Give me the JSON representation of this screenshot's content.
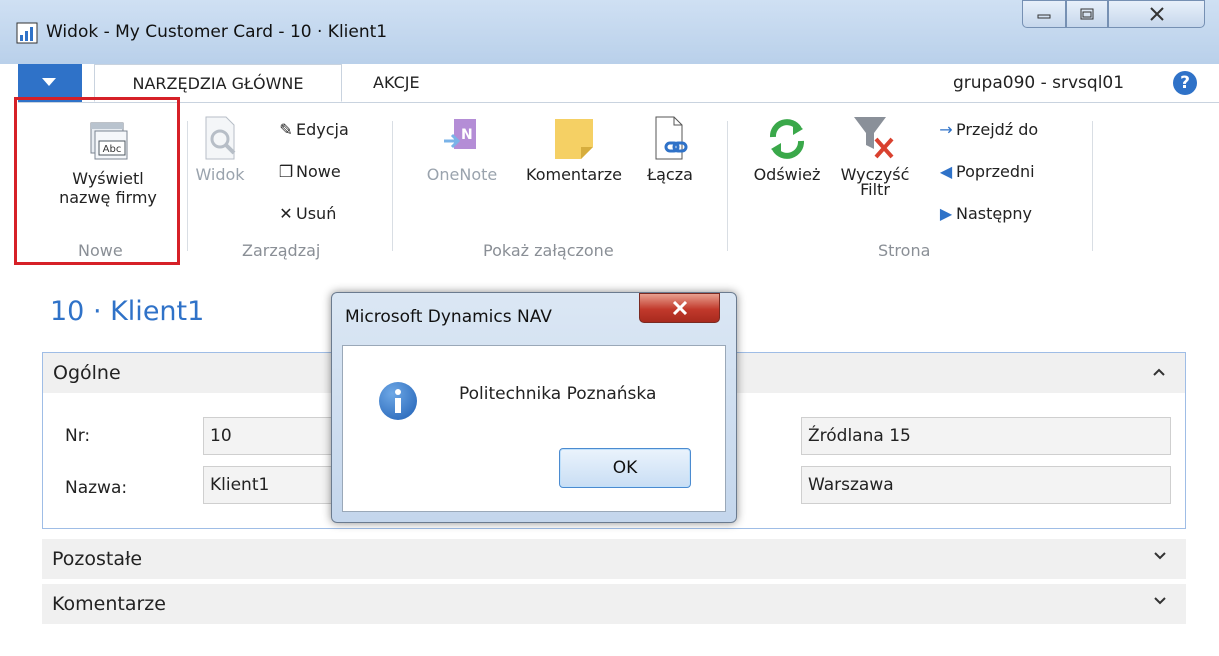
{
  "window": {
    "title": "Widok - My Customer Card - 10 · Klient1"
  },
  "tabs": {
    "home_label": "NARZĘDZIA GŁÓWNE",
    "actions_label": "AKCJE",
    "user_info": "grupa090 - srvsql01",
    "help_label": "?"
  },
  "ribbon": {
    "show_company_line1": "Wyświetl",
    "show_company_line2": "nazwę firmy",
    "group_new": "Nowe",
    "view_label": "Widok",
    "edit_label": "Edycja",
    "new_label": "Nowe",
    "delete_label": "Usuń",
    "group_manage": "Zarządzaj",
    "onenote_label": "OneNote",
    "comments_label": "Komentarze",
    "links_label": "Łącza",
    "group_attachments": "Pokaż załączone",
    "refresh_label": "Odśwież",
    "clear_filter_line1": "Wyczyść",
    "clear_filter_line2": "Filtr",
    "goto_label": "Przejdź do",
    "previous_label": "Poprzedni",
    "next_label": "Następny",
    "group_page": "Strona"
  },
  "page": {
    "title": "10 · Klient1"
  },
  "general": {
    "label": "Ogólne",
    "no_label": "Nr:",
    "no_value": "10",
    "name_label": "Nazwa:",
    "name_value": "Klient1",
    "address_value": "Źródlana 15",
    "city_value": "Warszawa"
  },
  "fasttabs": {
    "other_label": "Pozostałe",
    "comments_label": "Komentarze"
  },
  "dialog": {
    "title": "Microsoft Dynamics NAV",
    "message": "Politechnika Poznańska",
    "ok_label": "OK"
  },
  "colors": {
    "accent": "#2f72c8",
    "highlight": "#d62027"
  }
}
